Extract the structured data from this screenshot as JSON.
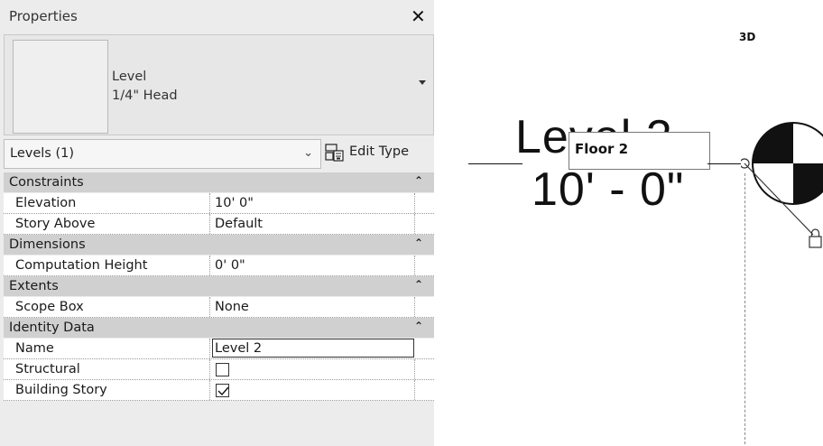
{
  "palette": {
    "title": "Properties",
    "close": "✕",
    "type_selector": {
      "family": "Level",
      "type": "1/4\" Head"
    },
    "filter": {
      "label": "Levels (1)",
      "chevron": "⌄"
    },
    "edit_type_label": "Edit Type",
    "groups": [
      {
        "title": "Constraints",
        "rows": [
          {
            "name": "Elevation",
            "value": "10'  0\""
          },
          {
            "name": "Story Above",
            "value": "Default"
          }
        ]
      },
      {
        "title": "Dimensions",
        "rows": [
          {
            "name": "Computation Height",
            "value": "0'  0\""
          }
        ]
      },
      {
        "title": "Extents",
        "rows": [
          {
            "name": "Scope Box",
            "value": "None"
          }
        ]
      },
      {
        "title": "Identity Data",
        "rows": [
          {
            "name": "Name",
            "value": "Level 2"
          },
          {
            "name": "Structural",
            "checked": false
          },
          {
            "name": "Building Story",
            "checked": true
          }
        ]
      }
    ],
    "collapse_glyph": "⌃"
  },
  "canvas": {
    "view_label": "3D",
    "level_name": "Level 2",
    "level_elevation": "10' - 0\"",
    "tooltip": "Floor 2"
  },
  "colors": {
    "palette_bg": "#ececec",
    "group_header": "#d0d0d0",
    "canvas_bg": "#ffffff"
  }
}
